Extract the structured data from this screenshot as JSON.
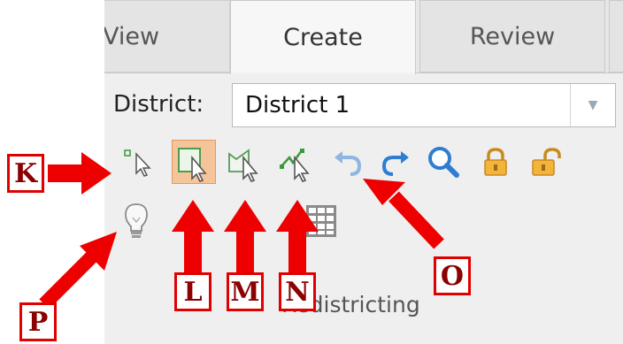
{
  "tabs": [
    {
      "label": "View"
    },
    {
      "label": "Create",
      "active": true
    },
    {
      "label": "Review"
    }
  ],
  "district": {
    "label": "District:",
    "selected": "District 1"
  },
  "toolbar_icons": [
    "select-point-icon",
    "select-rectangle-icon",
    "select-polygon-icon",
    "select-line-icon",
    "undo-icon",
    "redo-icon",
    "zoom-icon",
    "lock-icon",
    "unlock-icon",
    "lightbulb-icon",
    "grid-table-icon"
  ],
  "group_label": "Redistricting",
  "callouts": {
    "k": "K",
    "l": "L",
    "m": "M",
    "n": "N",
    "o": "O",
    "p": "P"
  },
  "colors": {
    "callout_border": "#e00000",
    "callout_text": "#8b0000",
    "arrow": "#ee0000",
    "active_tool_bg": "#f6c49a",
    "undo_redo": "#2f7dd1"
  }
}
